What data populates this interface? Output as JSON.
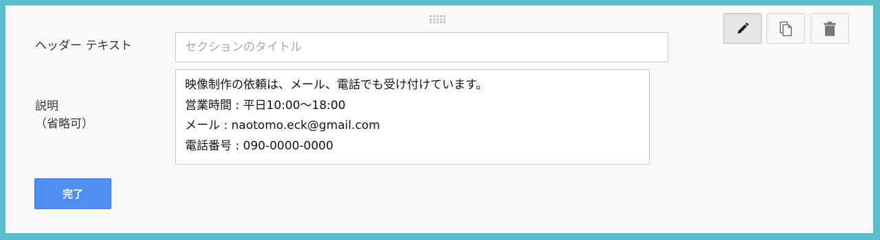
{
  "header_text": {
    "label": "ヘッダー テキスト",
    "placeholder": "セクションのタイトル",
    "value": ""
  },
  "description": {
    "label_line1": "説明",
    "label_line2": "（省略可）",
    "lines": [
      "映像制作の依頼は、メール、電話でも受け付けています。",
      "営業時間 : 平日10:00〜18:00",
      "メール : naotomo.eck@gmail.com",
      "電話番号 : 090-0000-0000"
    ]
  },
  "done_button": {
    "label": "完了"
  },
  "toolbar": {
    "edit_icon": "pencil-icon",
    "copy_icon": "copy-icon",
    "delete_icon": "trash-icon"
  },
  "colors": {
    "frame": "#5bbcca",
    "primary_button": "#4d8ef0"
  }
}
